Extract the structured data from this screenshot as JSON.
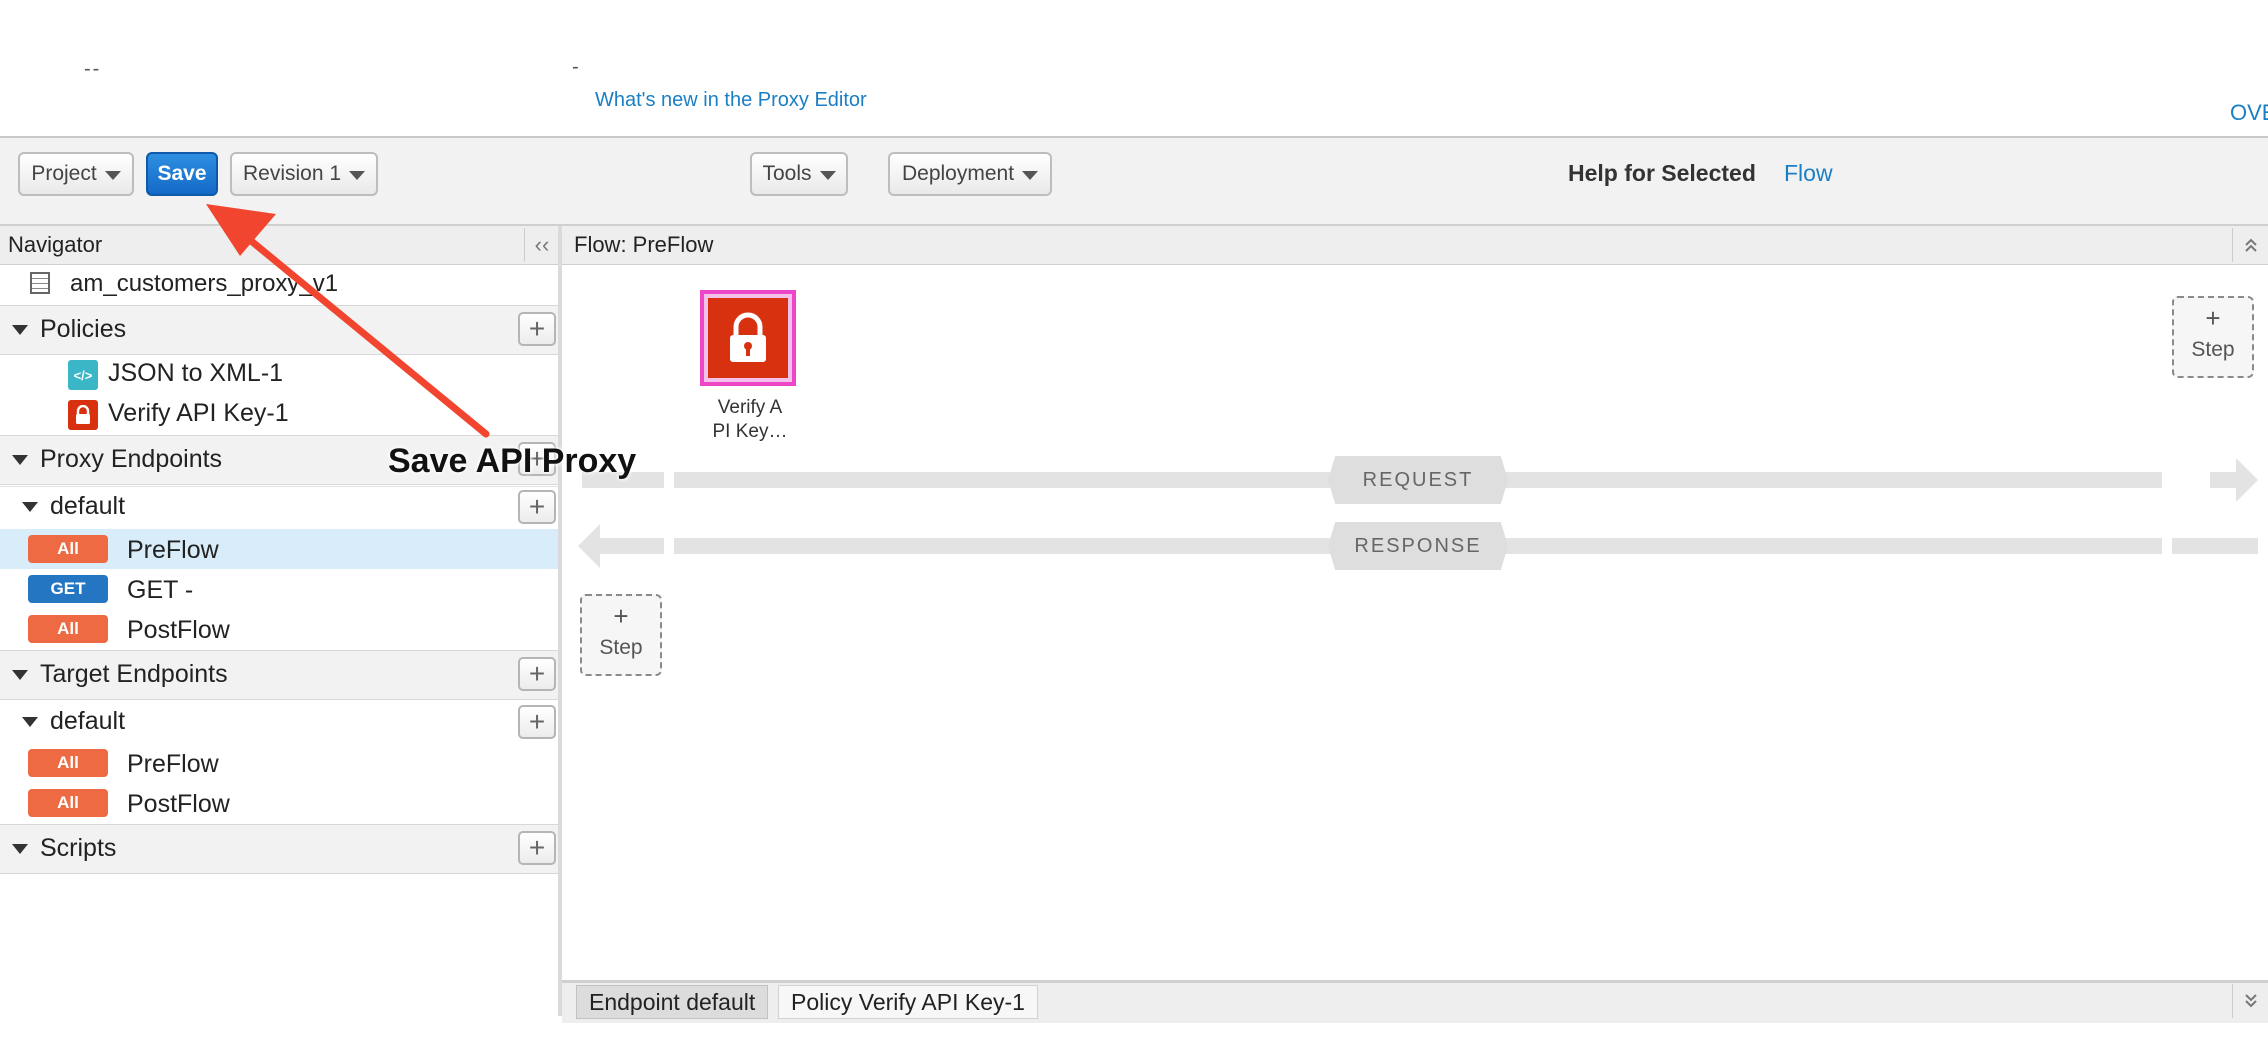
{
  "top": {
    "garble_left": "--",
    "garble_right": "-",
    "whats_new_link": "What's new in the Proxy Editor",
    "overview_link": "OVERVIEW"
  },
  "toolbar": {
    "project_label": "Project",
    "save_label": "Save",
    "revision_label": "Revision 1",
    "tools_label": "Tools",
    "deployment_label": "Deployment",
    "help_label": "Help for Selected",
    "help_link": "Flow"
  },
  "navigator": {
    "title": "Navigator",
    "collapse_glyph": "‹‹",
    "proxy_name": "am_customers_proxy_v1",
    "policies_label": "Policies",
    "policies": [
      {
        "label": "JSON to XML-1",
        "icon": "json-to-xml-icon",
        "color": "#3bb6c6"
      },
      {
        "label": "Verify API Key-1",
        "icon": "lock-icon",
        "color": "#d8310f"
      }
    ],
    "proxy_endpoints_label": "Proxy Endpoints",
    "proxy_default_label": "default",
    "proxy_flows": [
      {
        "badge": "All",
        "label": "PreFlow"
      },
      {
        "badge": "GET",
        "label": "GET -"
      },
      {
        "badge": "All",
        "label": "PostFlow"
      }
    ],
    "target_endpoints_label": "Target Endpoints",
    "target_default_label": "default",
    "target_flows": [
      {
        "badge": "All",
        "label": "PreFlow"
      },
      {
        "badge": "All",
        "label": "PostFlow"
      }
    ],
    "scripts_label": "Scripts",
    "plus_glyph": "+"
  },
  "flow": {
    "title": "Flow: PreFlow",
    "policy_caption_line1": "Verify A",
    "policy_caption_line2": "PI Key…",
    "step_plus": "+",
    "step_label": "Step",
    "request_label": "REQUEST",
    "response_label": "RESPONSE"
  },
  "bottom_tabs": {
    "endpoint_tab": "Endpoint default",
    "policy_tab": "Policy Verify API Key-1"
  },
  "annotation": {
    "text": "Save API Proxy",
    "arrow_color": "#f2452f"
  },
  "colors": {
    "accent_link": "#1a7fc4",
    "save_button": "#1a73d0",
    "badge_all": "#ee6a43",
    "badge_get": "#2475c2",
    "selected_row": "#d8ecf9",
    "policy_highlight": "#ee46c8"
  }
}
